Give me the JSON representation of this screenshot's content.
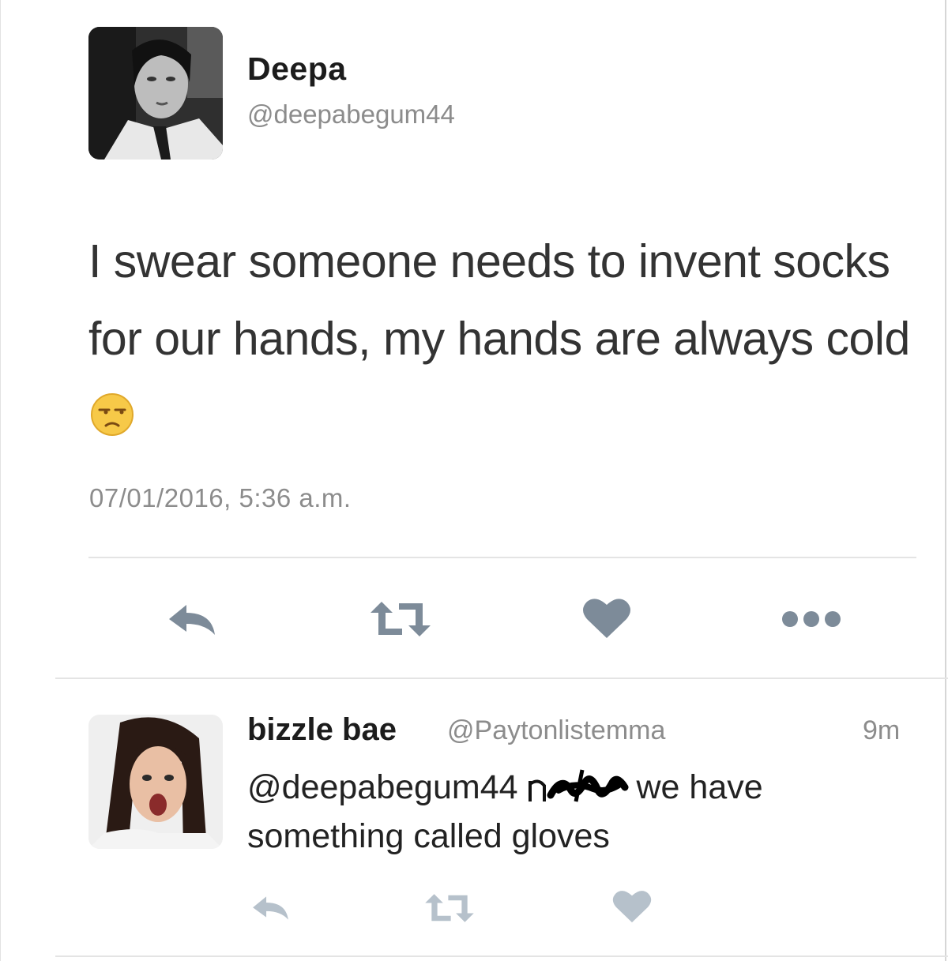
{
  "tweet": {
    "author_name": "Deepa",
    "author_handle": "@deepabegum44",
    "avatar_icon": "profile-photo-deepa",
    "text_before_emoji": "I swear someone needs to invent socks for our hands, my hands are always cold",
    "emoji_icon": "unamused-face-emoji",
    "timestamp": "07/01/2016, 5:36 a.m.",
    "actions": [
      {
        "name": "reply",
        "icon": "reply-arrow-icon"
      },
      {
        "name": "retweet",
        "icon": "retweet-icon"
      },
      {
        "name": "like",
        "icon": "heart-icon"
      },
      {
        "name": "more",
        "icon": "more-dots-icon"
      }
    ]
  },
  "reply": {
    "author_name": "bizzle bae",
    "author_handle": "@Paytonlistemma",
    "time_ago": "9m",
    "avatar_icon": "profile-photo-bizzle-bae",
    "mention": "@deepabegum44",
    "scribble_icon": "scribbled-out-word",
    "text_line1_end": "we have",
    "text_line2": "something called gloves",
    "actions": [
      {
        "name": "reply",
        "icon": "reply-arrow-icon"
      },
      {
        "name": "retweet",
        "icon": "retweet-icon"
      },
      {
        "name": "like",
        "icon": "heart-icon"
      }
    ]
  },
  "colors": {
    "icon_gray": "#7d8b99",
    "icon_light": "#b6c1cb",
    "secondary_text": "#8c8c8c"
  }
}
